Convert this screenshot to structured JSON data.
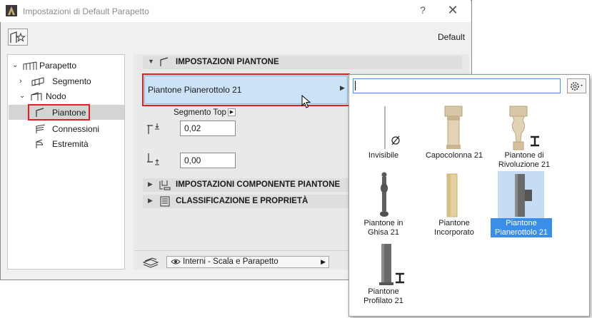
{
  "window": {
    "title": "Impostazioni di Default Parapetto",
    "help": "?",
    "close": "✕"
  },
  "header": {
    "default_label": "Default"
  },
  "tree": {
    "items": [
      {
        "label": "Parapetto"
      },
      {
        "label": "Segmento"
      },
      {
        "label": "Nodo"
      },
      {
        "label": "Piantone"
      },
      {
        "label": "Connessioni"
      },
      {
        "label": "Estremità"
      }
    ]
  },
  "panel": {
    "section1": "IMPOSTAZIONI PIANTONE",
    "chooser_label": "Piantone Pianerottolo 21",
    "segment_top_label": "Segmento Top",
    "value_top": "0,02",
    "value_bottom": "0,00",
    "section2": "IMPOSTAZIONI COMPONENTE PIANTONE",
    "section3": "CLASSIFICAZIONE E PROPRIETÀ",
    "layer": "Interni - Scala e Parapetto"
  },
  "popup": {
    "search_value": "",
    "items": [
      {
        "line1": "Invisibile",
        "line2": ""
      },
      {
        "line1": "Capocolonna 21",
        "line2": ""
      },
      {
        "line1": "Piantone di",
        "line2": "Rivoluzione 21"
      },
      {
        "line1": "Piantone in",
        "line2": "Ghisa 21"
      },
      {
        "line1": "Piantone",
        "line2": "Incorporato"
      },
      {
        "line1": "Piantone",
        "line2": "Pianerottolo 21"
      },
      {
        "line1": "Piantone",
        "line2": "Profilato 21"
      }
    ],
    "selected_index": 5
  },
  "colors": {
    "selection": "#3a8ee6",
    "highlight_box": "#e02020",
    "chooser_bg": "#cce3f7"
  }
}
